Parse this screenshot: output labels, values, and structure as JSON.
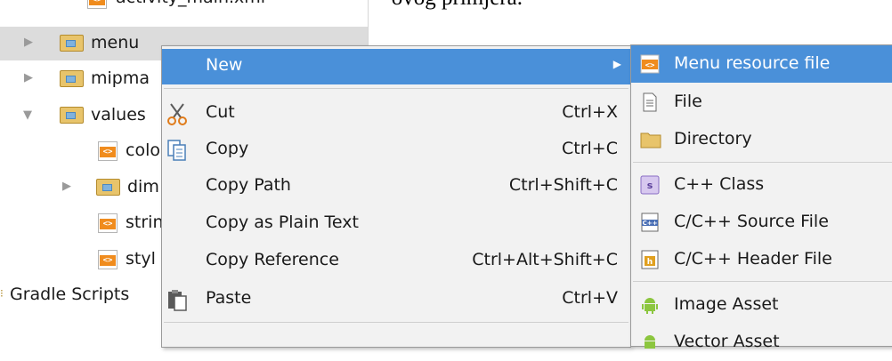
{
  "caption": "Taj kod se može vidjeti u sljedećem koraku ovog primjera.",
  "tree": {
    "items": [
      {
        "label": "activity_main.xml",
        "type": "xml"
      },
      {
        "label": "menu",
        "type": "folder"
      },
      {
        "label": "mipma",
        "type": "folder"
      },
      {
        "label": "values",
        "type": "folder"
      },
      {
        "label": "colo",
        "type": "xml"
      },
      {
        "label": "dim",
        "type": "folder"
      },
      {
        "label": "strin",
        "type": "xml"
      },
      {
        "label": "styl",
        "type": "xml"
      },
      {
        "label": "Gradle Scripts",
        "type": "group"
      }
    ]
  },
  "context_menu": {
    "items": [
      {
        "label": "New",
        "shortcut": "",
        "icon": ""
      },
      {
        "label": "Cut",
        "shortcut": "Ctrl+X",
        "icon": "scissors-icon"
      },
      {
        "label": "Copy",
        "shortcut": "Ctrl+C",
        "icon": "copy-icon"
      },
      {
        "label": "Copy Path",
        "shortcut": "Ctrl+Shift+C",
        "icon": ""
      },
      {
        "label": "Copy as Plain Text",
        "shortcut": "",
        "icon": ""
      },
      {
        "label": "Copy Reference",
        "shortcut": "Ctrl+Alt+Shift+C",
        "icon": ""
      },
      {
        "label": "Paste",
        "shortcut": "Ctrl+V",
        "icon": "paste-icon"
      }
    ]
  },
  "submenu": {
    "items": [
      {
        "label": "Menu resource file",
        "icon": "xml-file-icon"
      },
      {
        "label": "File",
        "icon": "file-icon"
      },
      {
        "label": "Directory",
        "icon": "folder-icon"
      },
      {
        "label": "C++ Class",
        "icon": "cpp-class-icon"
      },
      {
        "label": "C/C++ Source File",
        "icon": "cpp-source-icon"
      },
      {
        "label": "C/C++ Header File",
        "icon": "cpp-header-icon"
      },
      {
        "label": "Image Asset",
        "icon": "android-icon"
      },
      {
        "label": "Vector Asset",
        "icon": "android-icon"
      }
    ]
  },
  "colors": {
    "highlight": "#4a90d9",
    "menu_bg": "#f2f2f2",
    "selected_row": "#dcdcdc"
  }
}
